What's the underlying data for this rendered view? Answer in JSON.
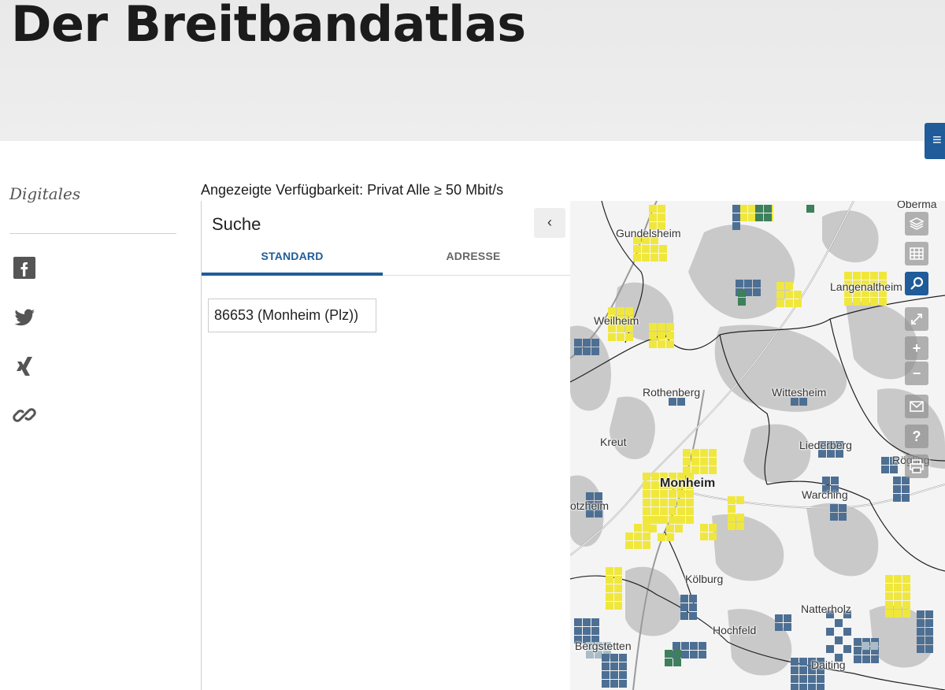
{
  "header": {
    "title": "Der Breitbandatlas"
  },
  "sidebar": {
    "section_label": "Digitales"
  },
  "share": {
    "icons": [
      "facebook-icon",
      "twitter-icon",
      "xing-icon",
      "link-icon"
    ]
  },
  "availability_text": "Angezeigte Verfügbarkeit: Privat Alle ≥ 50 Mbit/s",
  "search_panel": {
    "title": "Suche",
    "tabs": [
      "STANDARD",
      "ADRESSE"
    ],
    "active_tab": "STANDARD",
    "search_value": "86653 (Monheim (Plz))",
    "collapse_glyph": "‹"
  },
  "map": {
    "places": [
      "Gundelsheim",
      "Langenaltheim",
      "Weilheim",
      "Rothenberg",
      "Wittesheim",
      "Kreut",
      "Liederberg",
      "Monheim",
      "Warching",
      "otzheim",
      "Kölburg",
      "Natterholz",
      "Hochfeld",
      "Bergstetten",
      "Daiting",
      "Oberma",
      "Rögling"
    ],
    "controls": [
      "layers-icon",
      "table-icon",
      "search-icon",
      "fullscreen-icon",
      "zoom-in-icon",
      "zoom-out-icon",
      "mail-icon",
      "help-icon",
      "print-icon"
    ],
    "colors": {
      "available": "#f0e73d",
      "partial": "#4d6f93",
      "light": "#a9bcc7",
      "green": "#3e7f5c",
      "accent": "#1f5c99"
    }
  }
}
